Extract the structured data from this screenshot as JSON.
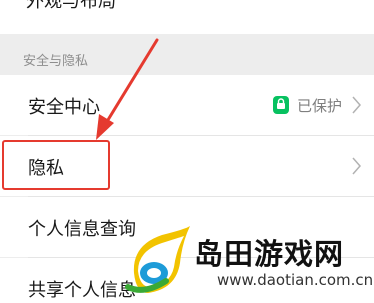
{
  "top_row": {
    "label": "外观与布局"
  },
  "section": {
    "header": "安全与隐私"
  },
  "rows": [
    {
      "label": "安全中心",
      "status": "已保护"
    },
    {
      "label": "隐私"
    },
    {
      "label": "个人信息查询"
    },
    {
      "label": "共享个人信息"
    }
  ],
  "colors": {
    "background": "#ededed",
    "highlight": "#e53a2f",
    "shield_green": "#07c160"
  },
  "icons": {
    "chevron": "chevron-right-icon",
    "shield": "shield-check-icon",
    "arrow": "annotation-arrow"
  },
  "watermark": {
    "name": "岛田游戏网",
    "url": "www.daotian.com.cn"
  }
}
